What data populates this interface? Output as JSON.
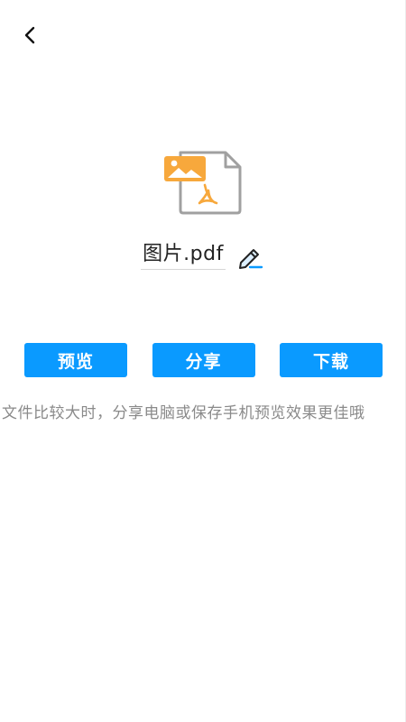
{
  "navigation": {
    "back_icon": "chevron-left-icon"
  },
  "file": {
    "icon": "pdf-file-icon",
    "name": "图片.pdf",
    "edit_icon": "pencil-icon"
  },
  "actions": {
    "preview_label": "预览",
    "share_label": "分享",
    "download_label": "下载"
  },
  "hint": {
    "text": "文件比较大时，分享电脑或保存手机预览效果更佳哦"
  },
  "colors": {
    "accent": "#0a9aff",
    "file_badge": "#f7a83c",
    "file_outline": "#a0a0a0"
  }
}
